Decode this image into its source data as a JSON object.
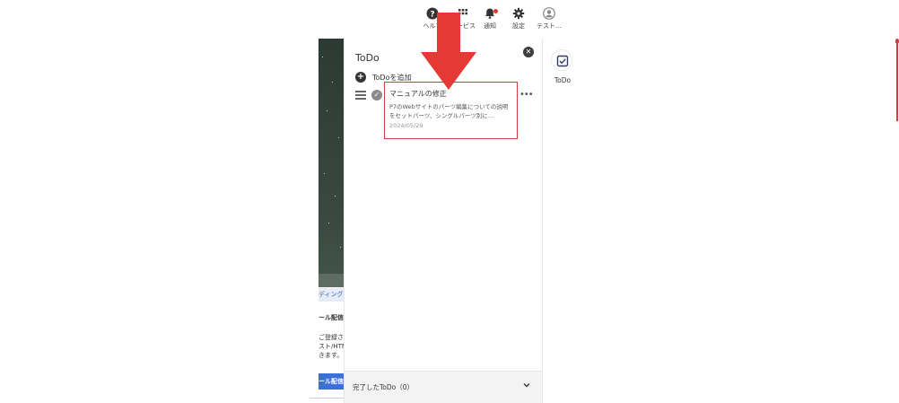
{
  "header": {
    "help_label": "ヘルプ",
    "service_label": "サービス",
    "notify_label": "通知",
    "settings_label": "設定",
    "user_label": "テスト…",
    "notification_dot_color": "#e53935"
  },
  "background": {
    "tab_label": "ディング",
    "heading": "ール配信",
    "line1": "ご登録され",
    "line2": "スト/HTM",
    "line3": "きます。",
    "button_label": "ール配信"
  },
  "todo_panel": {
    "title": "ToDo",
    "add_label": "ToDoを追加",
    "items": [
      {
        "title": "マニュアルの修正",
        "description": "P7のWebサイトのパーツ編集についての説明をセットパーツ、シングルパーツ別に…",
        "date": "2024/05/29"
      }
    ],
    "completed_label": "完了したToDo（0）"
  },
  "right_rail": {
    "todo_label": "ToDo"
  },
  "colors": {
    "highlight_border": "#d23b3b",
    "arrow": "#e53935",
    "accent_blue": "#3c6fd8"
  }
}
